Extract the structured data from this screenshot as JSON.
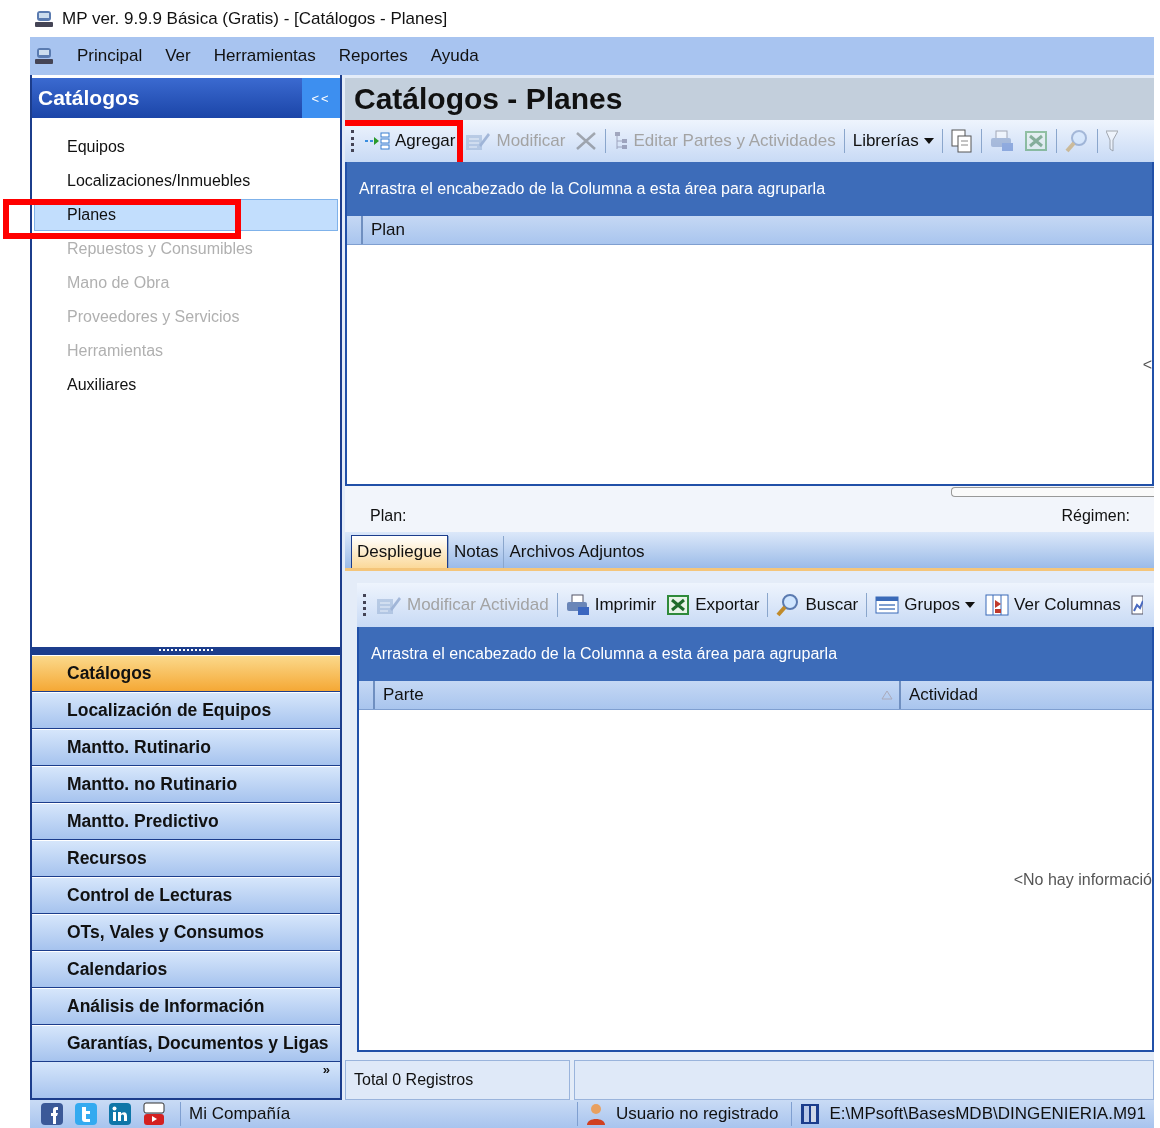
{
  "window": {
    "title": "MP ver. 9.9.9 Básica (Gratis) - [Catálogos - Planes]"
  },
  "menu": [
    "Principal",
    "Ver",
    "Herramientas",
    "Reportes",
    "Ayuda"
  ],
  "sidebar": {
    "title": "Catálogos",
    "collapse": "<<",
    "items": [
      {
        "label": "Equipos",
        "disabled": false,
        "selected": false,
        "marked": false
      },
      {
        "label": "Localizaciones/Inmuebles",
        "disabled": false,
        "selected": false,
        "marked": false
      },
      {
        "label": "Planes",
        "disabled": false,
        "selected": true,
        "marked": true
      },
      {
        "label": "Repuestos y Consumibles",
        "disabled": true,
        "selected": false,
        "marked": false
      },
      {
        "label": "Mano de Obra",
        "disabled": true,
        "selected": false,
        "marked": false
      },
      {
        "label": "Proveedores y Servicios",
        "disabled": true,
        "selected": false,
        "marked": false
      },
      {
        "label": "Herramientas",
        "disabled": true,
        "selected": false,
        "marked": false
      },
      {
        "label": "Auxiliares",
        "disabled": false,
        "selected": false,
        "marked": false
      }
    ],
    "nav": [
      {
        "label": "Catálogos",
        "selected": true
      },
      {
        "label": "Localización de Equipos",
        "selected": false
      },
      {
        "label": "Mantto. Rutinario",
        "selected": false
      },
      {
        "label": "Mantto. no Rutinario",
        "selected": false
      },
      {
        "label": "Mantto. Predictivo",
        "selected": false
      },
      {
        "label": "Recursos",
        "selected": false
      },
      {
        "label": "Control de Lecturas",
        "selected": false
      },
      {
        "label": "OTs, Vales y Consumos",
        "selected": false
      },
      {
        "label": "Calendarios",
        "selected": false
      },
      {
        "label": "Análisis de Información",
        "selected": false
      },
      {
        "label": "Garantías, Documentos y Ligas",
        "selected": false
      }
    ],
    "more": "»"
  },
  "content": {
    "title": "Catálogos - Planes",
    "toolbar": [
      {
        "kind": "add",
        "label": "Agregar",
        "disabled": false,
        "marked": true
      },
      {
        "kind": "edit",
        "label": "Modificar",
        "disabled": true,
        "marked": false
      },
      {
        "kind": "delete",
        "disabled": true,
        "marked": false
      },
      {
        "kind": "separator"
      },
      {
        "kind": "tree",
        "label": "Editar Partes y Actividades",
        "disabled": true,
        "marked": false
      },
      {
        "kind": "separator"
      },
      {
        "kind": "dropdown",
        "label": "Librerías",
        "disabled": false,
        "marked": false
      },
      {
        "kind": "separator"
      },
      {
        "kind": "copy",
        "disabled": false,
        "marked": false
      },
      {
        "kind": "separator"
      },
      {
        "kind": "print",
        "disabled": true,
        "marked": false
      },
      {
        "kind": "export",
        "disabled": true,
        "marked": false
      },
      {
        "kind": "separator"
      },
      {
        "kind": "search",
        "disabled": true,
        "marked": false
      },
      {
        "kind": "separator"
      },
      {
        "kind": "filter",
        "disabled": true,
        "marked": false
      }
    ],
    "grid": {
      "group_hint": "Arrastra el encabezado de la Columna a esta área para agruparla",
      "columns": [
        {
          "label": "Plan",
          "sorted": false
        }
      ],
      "empty_text": "<"
    },
    "detail": {
      "fields": [
        "Plan:",
        "Régimen:"
      ],
      "tabs": [
        {
          "label": "Despliegue",
          "selected": true
        },
        {
          "label": "Notas",
          "selected": false
        },
        {
          "label": "Archivos Adjuntos",
          "selected": false
        }
      ],
      "toolbar": [
        {
          "kind": "edit",
          "label": "Modificar Actividad",
          "disabled": true
        },
        {
          "kind": "separator"
        },
        {
          "kind": "print",
          "label": "Imprimir",
          "disabled": false
        },
        {
          "kind": "export",
          "label": "Exportar",
          "disabled": false
        },
        {
          "kind": "separator"
        },
        {
          "kind": "search",
          "label": "Buscar",
          "disabled": false
        },
        {
          "kind": "separator"
        },
        {
          "kind": "groups",
          "label": "Grupos",
          "disabled": false
        },
        {
          "kind": "columns",
          "label": "Ver Columnas",
          "disabled": false
        },
        {
          "kind": "chart",
          "disabled": false
        }
      ],
      "grid": {
        "group_hint": "Arrastra el encabezado de la Columna a esta área para agruparla",
        "columns": [
          {
            "label": "Parte",
            "sorted": true
          },
          {
            "label": "Actividad",
            "sorted": false
          }
        ],
        "empty_text": "<No hay informació"
      },
      "footer": [
        "Total 0 Registros"
      ]
    }
  },
  "status_bar": {
    "links": [
      {
        "kind": "facebook"
      },
      {
        "kind": "twitter"
      },
      {
        "kind": "linkedin"
      },
      {
        "kind": "youtube"
      }
    ],
    "company": "Mi Compañía",
    "user": "Usuario no registrado",
    "database": "E:\\MPsoft\\BasesMDB\\DINGENIERIA.M91"
  }
}
